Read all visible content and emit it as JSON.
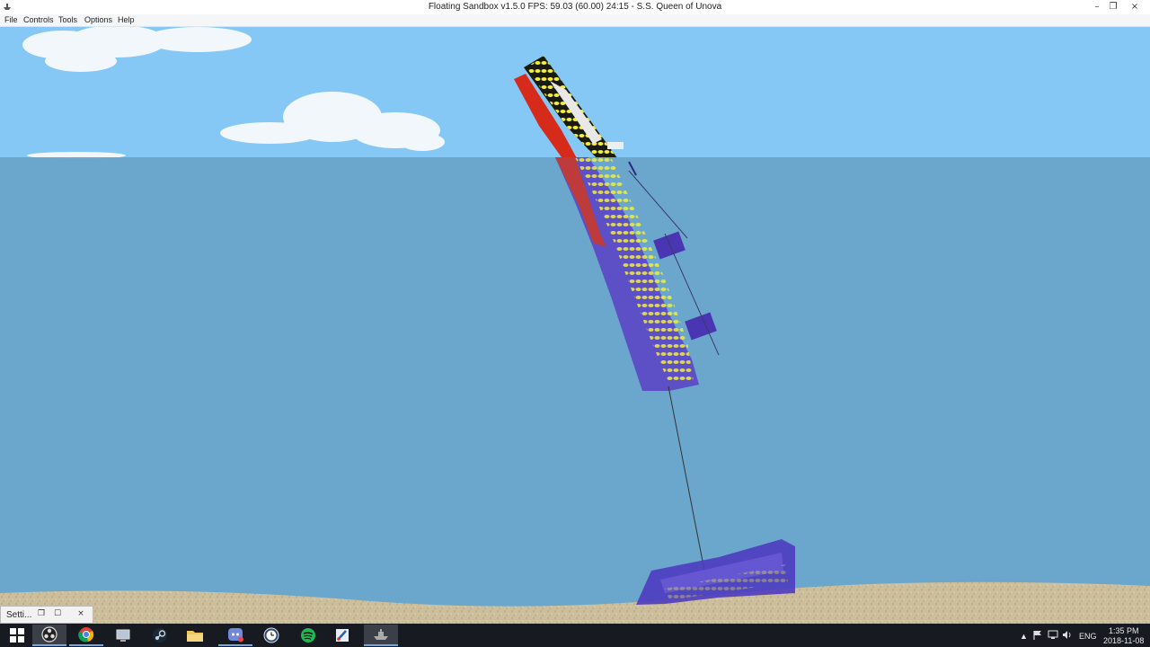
{
  "window": {
    "title": "Floating Sandbox v1.5.0  FPS: 59.03 (60.00) 24:15 - S.S. Queen of Unova",
    "minimize_glyph": "–",
    "restore_glyph": "❐",
    "close_glyph": "×"
  },
  "menu": {
    "items": [
      "File",
      "Controls",
      "Tools",
      "Options",
      "Help"
    ]
  },
  "scene": {
    "colors": {
      "sky": "#85c8f5",
      "water": "#6ba7cd",
      "sand": "#cdbf9c",
      "hull_red": "#d62b1b",
      "hull_blue": "#5a3fc4",
      "lights": "#f2ee3c"
    }
  },
  "mini_window": {
    "label": "Setti...",
    "restore_glyph": "❐",
    "maximize_glyph": "☐",
    "close_glyph": "×"
  },
  "taskbar": {
    "apps": [
      "start",
      "obs",
      "chrome",
      "explorer-misc",
      "steam",
      "file-explorer",
      "discord",
      "clock",
      "spotify",
      "paint",
      "floating-sandbox"
    ],
    "tray": {
      "chevron": "▲",
      "language": "ENG",
      "time": "1:35 PM",
      "date": "2018-11-08"
    }
  }
}
